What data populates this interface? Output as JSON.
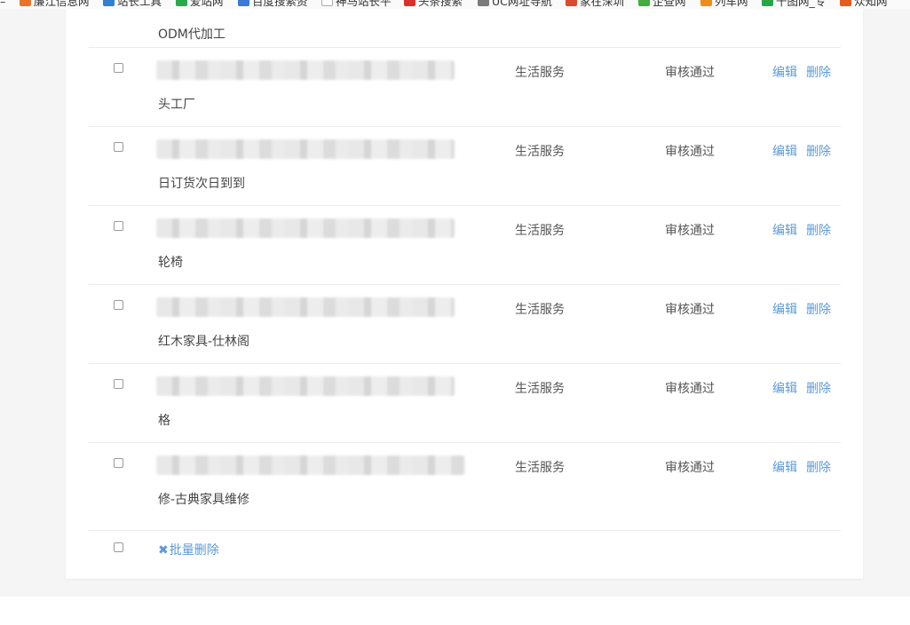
{
  "bookmarks": [
    {
      "label": "廉江信息网",
      "color": "#e8742b"
    },
    {
      "label": "站长工具",
      "color": "#2f7fd3"
    },
    {
      "label": "爱站网",
      "color": "#2aa84a"
    },
    {
      "label": "百度搜索资",
      "color": "#3a78d6"
    },
    {
      "label": "神马站长平",
      "color": "#cfcfcf"
    },
    {
      "label": "头条搜索",
      "color": "#d9312b"
    },
    {
      "label": "UC网址导航",
      "color": "#7a7a7a"
    },
    {
      "label": "家在深圳",
      "color": "#d94b2b"
    },
    {
      "label": "企查网",
      "color": "#3fae3a"
    },
    {
      "label": "列车网",
      "color": "#f08c1a"
    },
    {
      "label": "千图网_专",
      "color": "#27a647"
    },
    {
      "label": "众知网",
      "color": "#e55a1e"
    }
  ],
  "top_fragment": "ODM代加工",
  "rows": [
    {
      "line2": "头工厂",
      "category": "生活服务",
      "status": "审核通过",
      "edit": "编辑",
      "delete": "删除"
    },
    {
      "line2": "日订货次日到到",
      "category": "生活服务",
      "status": "审核通过",
      "edit": "编辑",
      "delete": "删除"
    },
    {
      "line2": "轮椅",
      "category": "生活服务",
      "status": "审核通过",
      "edit": "编辑",
      "delete": "删除"
    },
    {
      "line2": "红木家具-仕林阁",
      "category": "生活服务",
      "status": "审核通过",
      "edit": "编辑",
      "delete": "删除"
    },
    {
      "line2": "格",
      "category": "生活服务",
      "status": "审核通过",
      "edit": "编辑",
      "delete": "删除"
    },
    {
      "line2": "修-古典家具维修",
      "category": "生活服务",
      "status": "审核通过",
      "edit": "编辑",
      "delete": "删除"
    }
  ],
  "batch_delete": {
    "icon": "✖",
    "label": "批量删除"
  }
}
